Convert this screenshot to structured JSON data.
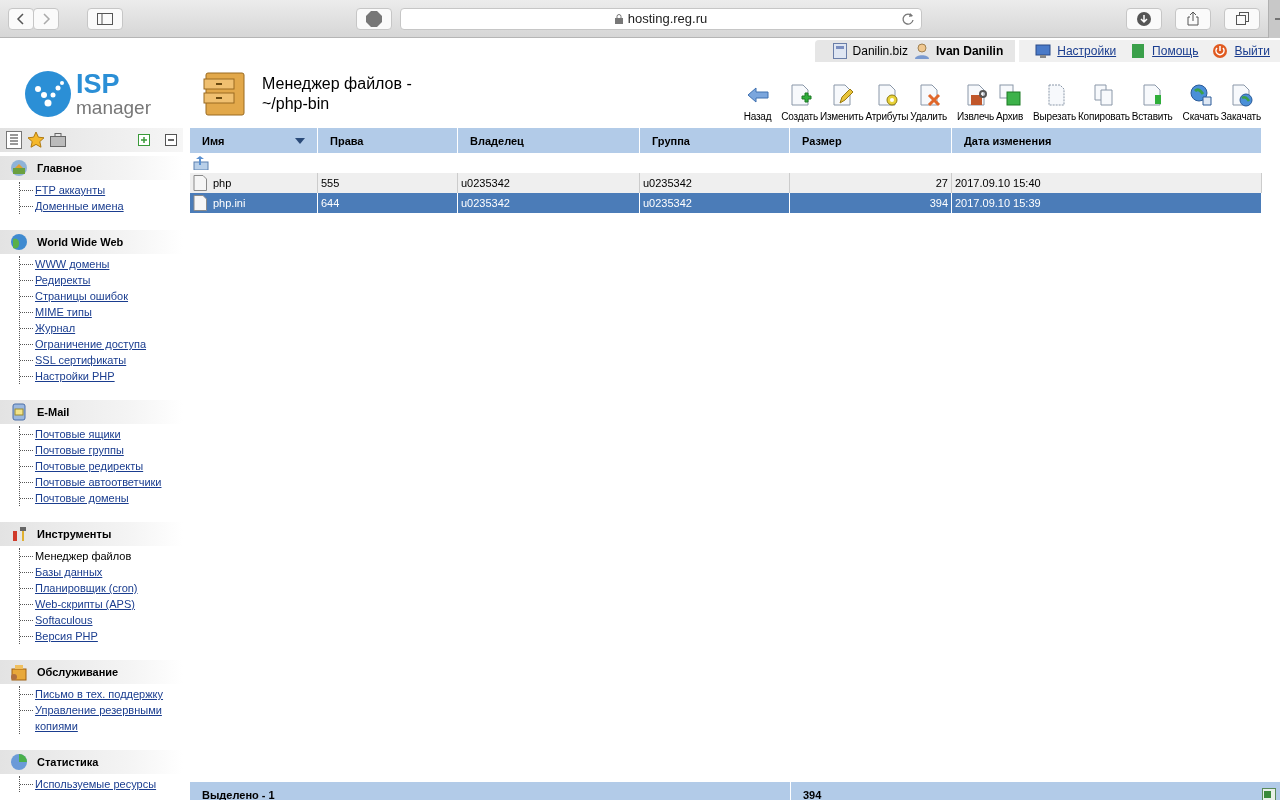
{
  "browser": {
    "address": "hosting.reg.ru"
  },
  "user_bar": {
    "domain": "Danilin.biz",
    "user": "Ivan Danilin",
    "links": [
      {
        "label": "Настройки",
        "kind": "settings"
      },
      {
        "label": "Помощь",
        "kind": "help"
      },
      {
        "label": "Выйти",
        "kind": "exit"
      }
    ]
  },
  "logo": {
    "line1": "ISP",
    "line2": "manager"
  },
  "page_title": "Менеджер файлов - ~/php-bin",
  "toolbar": [
    [
      {
        "label": "Назад",
        "kind": "back"
      }
    ],
    [
      {
        "label": "Создать",
        "kind": "create"
      },
      {
        "label": "Изменить",
        "kind": "edit"
      },
      {
        "label": "Атрибуты",
        "kind": "attributes"
      },
      {
        "label": "Удалить",
        "kind": "delete"
      }
    ],
    [
      {
        "label": "Извлечь",
        "kind": "extract"
      },
      {
        "label": "Архив",
        "kind": "archive"
      }
    ],
    [
      {
        "label": "Вырезать",
        "kind": "cut"
      },
      {
        "label": "Копировать",
        "kind": "copy"
      },
      {
        "label": "Вставить",
        "kind": "paste"
      }
    ],
    [
      {
        "label": "Скачать",
        "kind": "download"
      },
      {
        "label": "Закачать",
        "kind": "upload"
      }
    ]
  ],
  "sidebar": {
    "sections": [
      {
        "title": "Главное",
        "kind": "main",
        "items": [
          {
            "label": "FTP аккаунты",
            "selected": false
          },
          {
            "label": "Доменные имена",
            "selected": false
          }
        ]
      },
      {
        "title": "World Wide Web",
        "kind": "web",
        "items": [
          {
            "label": "WWW домены",
            "selected": false
          },
          {
            "label": "Редиректы",
            "selected": false
          },
          {
            "label": "Страницы ошибок",
            "selected": false
          },
          {
            "label": "MIME типы",
            "selected": false
          },
          {
            "label": "Журнал",
            "selected": false
          },
          {
            "label": "Ограничение доступа",
            "selected": false
          },
          {
            "label": "SSL сертификаты",
            "selected": false
          },
          {
            "label": "Настройки PHP",
            "selected": false
          }
        ]
      },
      {
        "title": "E-Mail",
        "kind": "mail",
        "items": [
          {
            "label": "Почтовые ящики",
            "selected": false
          },
          {
            "label": "Почтовые группы",
            "selected": false
          },
          {
            "label": "Почтовые редиректы",
            "selected": false
          },
          {
            "label": "Почтовые автоответчики",
            "selected": false
          },
          {
            "label": "Почтовые домены",
            "selected": false
          }
        ]
      },
      {
        "title": "Инструменты",
        "kind": "tools",
        "items": [
          {
            "label": "Менеджер файлов",
            "selected": true
          },
          {
            "label": "Базы данных",
            "selected": false
          },
          {
            "label": "Планировщик (cron)",
            "selected": false
          },
          {
            "label": "Web-скрипты (APS)",
            "selected": false
          },
          {
            "label": "Softaculous",
            "selected": false
          },
          {
            "label": "Версия PHP",
            "selected": false
          }
        ]
      },
      {
        "title": "Обслуживание",
        "kind": "service",
        "items": [
          {
            "label": "Письмо в тех. поддержку",
            "selected": false
          },
          {
            "label": "Управление резервными копиями",
            "selected": false
          }
        ]
      },
      {
        "title": "Статистика",
        "kind": "stats",
        "items": [
          {
            "label": "Используемые ресурсы",
            "selected": false
          }
        ]
      }
    ]
  },
  "table": {
    "columns": [
      {
        "label": "Имя",
        "sorted": true
      },
      {
        "label": "Права",
        "sorted": false
      },
      {
        "label": "Владелец",
        "sorted": false
      },
      {
        "label": "Группа",
        "sorted": false
      },
      {
        "label": "Размер",
        "sorted": false
      },
      {
        "label": "Дата изменения",
        "sorted": false
      }
    ],
    "rows": [
      {
        "cells": [
          "php",
          "555",
          "u0235342",
          "u0235342",
          "27",
          "2017.09.10 15:40"
        ],
        "selected": false
      },
      {
        "cells": [
          "php.ini",
          "644",
          "u0235342",
          "u0235342",
          "394",
          "2017.09.10 15:39"
        ],
        "selected": true
      }
    ]
  },
  "status_bar": {
    "selection": "Выделено - 1",
    "size": "394"
  }
}
